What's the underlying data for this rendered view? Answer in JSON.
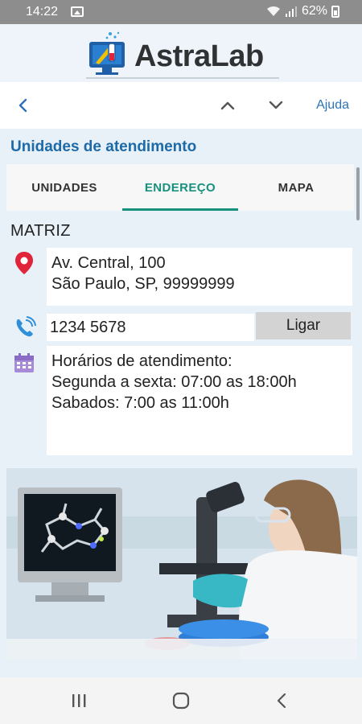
{
  "status_bar": {
    "time": "14:22",
    "battery": "62%"
  },
  "header": {
    "app_name": "AstraLab"
  },
  "nav": {
    "help_label": "Ajuda"
  },
  "page": {
    "title": "Unidades de atendimento"
  },
  "tabs": [
    {
      "label": "UNIDADES",
      "active": false
    },
    {
      "label": "ENDEREÇO",
      "active": true
    },
    {
      "label": "MAPA",
      "active": false
    }
  ],
  "unit": {
    "name": "MATRIZ",
    "address_line1": "Av. Central, 100",
    "address_line2": "São Paulo, SP, 99999999",
    "phone": "1234 5678",
    "call_label": "Ligar",
    "hours_title": "Horários de atendimento:",
    "hours_weekdays": "Segunda a sexta: 07:00 as 18:00h",
    "hours_saturday": "Sabados: 7:00 as 11:00h"
  },
  "icons": {
    "location": "map-pin-icon",
    "phone": "phone-icon",
    "calendar": "calendar-icon"
  },
  "colors": {
    "accent": "#17907e",
    "title_blue": "#1c6aa8",
    "pin_red": "#e0243a",
    "phone_blue": "#2f8fd8",
    "calendar_purple": "#a78bd6"
  }
}
